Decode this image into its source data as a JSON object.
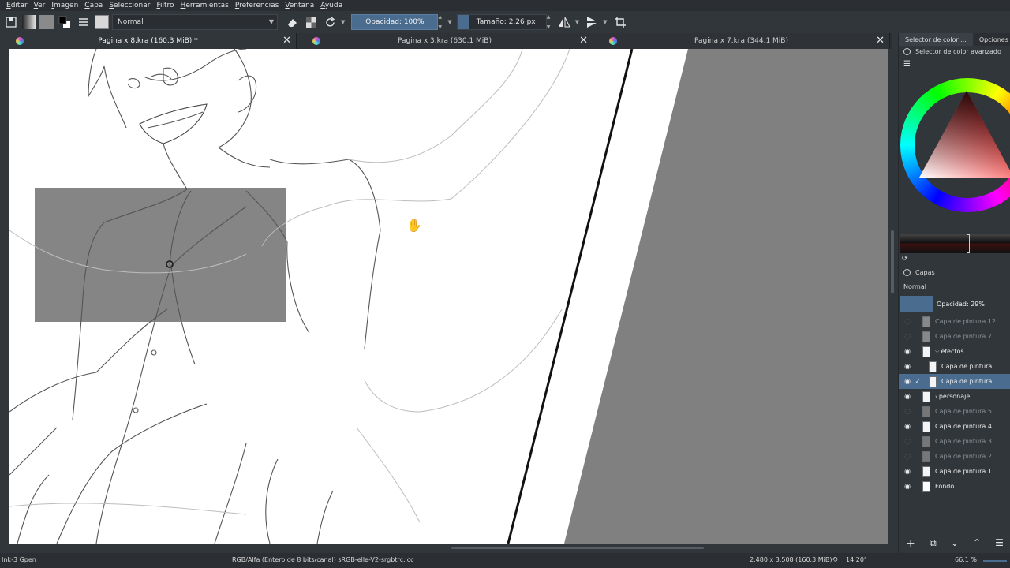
{
  "menu": [
    "Editar",
    "Ver",
    "Imagen",
    "Capa",
    "Seleccionar",
    "Filtro",
    "Herramientas",
    "Preferencias",
    "Ventana",
    "Ayuda"
  ],
  "toolbar": {
    "blend_mode": "Normal",
    "opacity_label": "Opacidad: 100%",
    "size_label": "Tamaño: 2.26 px"
  },
  "tabs": [
    {
      "label": "Pagina x 8.kra (160.3 MiB) *",
      "active": true
    },
    {
      "label": "Pagina x 3.kra (630.1 MiB)",
      "active": false
    },
    {
      "label": "Pagina x 7.kra (344.1 MiB)",
      "active": false
    }
  ],
  "dock": {
    "tabs": [
      "Selector de color ...",
      "Opciones d"
    ],
    "color_selector_title": "Selector de color avanzado",
    "layers_title": "Capas",
    "layers_blend": "Normal",
    "layers_opacity": "Opacidad:  29%",
    "layers": [
      {
        "name": "Capa de pintura 12",
        "visible": false,
        "indent": 0,
        "selected": false
      },
      {
        "name": "Capa de pintura 7",
        "visible": false,
        "indent": 0,
        "selected": false
      },
      {
        "name": "efectos",
        "visible": true,
        "indent": 0,
        "selected": false,
        "group": true
      },
      {
        "name": "Capa de pintura...",
        "visible": true,
        "indent": 1,
        "selected": false
      },
      {
        "name": "Capa de pintura...",
        "visible": true,
        "indent": 1,
        "selected": true
      },
      {
        "name": "personaje",
        "visible": true,
        "indent": 0,
        "selected": false,
        "group": true
      },
      {
        "name": "Capa de pintura 5",
        "visible": false,
        "indent": 0,
        "selected": false
      },
      {
        "name": "Capa de pintura 4",
        "visible": true,
        "indent": 0,
        "selected": false
      },
      {
        "name": "Capa de pintura 3",
        "visible": false,
        "indent": 0,
        "selected": false
      },
      {
        "name": "Capa de pintura 2",
        "visible": false,
        "indent": 0,
        "selected": false
      },
      {
        "name": "Capa de pintura 1",
        "visible": true,
        "indent": 0,
        "selected": false
      },
      {
        "name": "Fondo",
        "visible": true,
        "indent": 0,
        "selected": false
      }
    ]
  },
  "status": {
    "brush": "Ink-3 Gpen",
    "color_info": "RGB/Alfa (Entero de 8 bits/canal)  sRGB-elle-V2-srgbtrc.icc",
    "dimensions": "2,480 x 3,508 (160.3 MiB)",
    "rotation": "14.20°",
    "zoom": "66.1 %"
  },
  "colors": {
    "accent": "#4a6c8f",
    "panel": "#31363b",
    "canvas_gray": "#808080"
  }
}
